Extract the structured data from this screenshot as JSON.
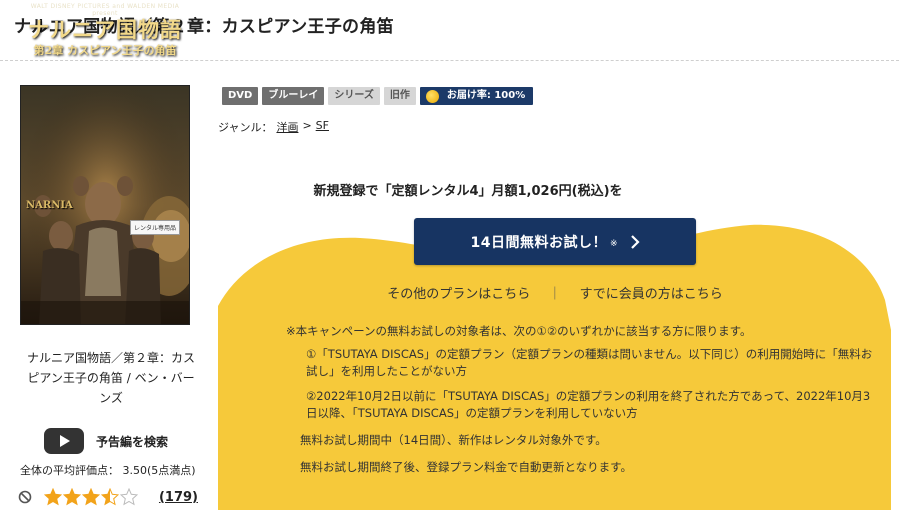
{
  "page": {
    "title": "ナルニア国物語／第２章：カスピアン王子の角笛"
  },
  "poster": {
    "studio_line": "WALT DISNEY PICTURES and WALDEN MEDIA present",
    "title_main": "ナルニア国物語",
    "title_sub": "第2章 カスピアン王子の角笛",
    "logo_text": "NARNIA",
    "rental_badge": "レンタル専用品"
  },
  "work": {
    "caption": "ナルニア国物語／第２章：カスピアン王子の角笛 / ベン・バーンズ"
  },
  "trailer": {
    "label": "予告編を検索"
  },
  "rating": {
    "average_text": "全体の平均評価点： 3.50(5点満点)",
    "average_value": 3.5,
    "max": 5,
    "review_count": "(179)"
  },
  "tags": [
    {
      "label": "DVD",
      "style": "dark"
    },
    {
      "label": "ブルーレイ",
      "style": "dark"
    },
    {
      "label": "シリーズ",
      "style": "light"
    },
    {
      "label": "旧作",
      "style": "light"
    }
  ],
  "delivery": {
    "label": "お届け率: 100%"
  },
  "genre": {
    "label": "ジャンル：",
    "path": [
      "洋画",
      "SF"
    ],
    "separator": ">"
  },
  "promo": {
    "headline": "新規登録で「定額レンタル4」月額1,026円(税込)を"
  },
  "trial": {
    "label": "14日間無料お試し！",
    "note": "※"
  },
  "plans": {
    "other_plans": "その他のプランはこちら",
    "separator": "｜",
    "members": "すでに会員の方はこちら"
  },
  "notice": {
    "intro": "※本キャンペーンの無料お試しの対象者は、次の①②のいずれかに該当する方に限ります。",
    "item1": "①「TSUTAYA DISCAS」の定額プラン（定額プランの種類は問いません。以下同じ）の利用開始時に「無料お試し」を利用したことがない方",
    "item2": "②2022年10月2日以前に「TSUTAYA DISCAS」の定額プランの利用を終了された方であって、2022年10月3日以降、「TSUTAYA DISCAS」の定額プランを利用していない方",
    "line3": "無料お試し期間中（14日間）、新作はレンタル対象外です。",
    "line4": "無料お試し期間終了後、登録プラン料金で自動更新となります。"
  },
  "colors": {
    "navy": "#173462",
    "yellow": "#f6c93a",
    "star": "#f2a31a"
  }
}
